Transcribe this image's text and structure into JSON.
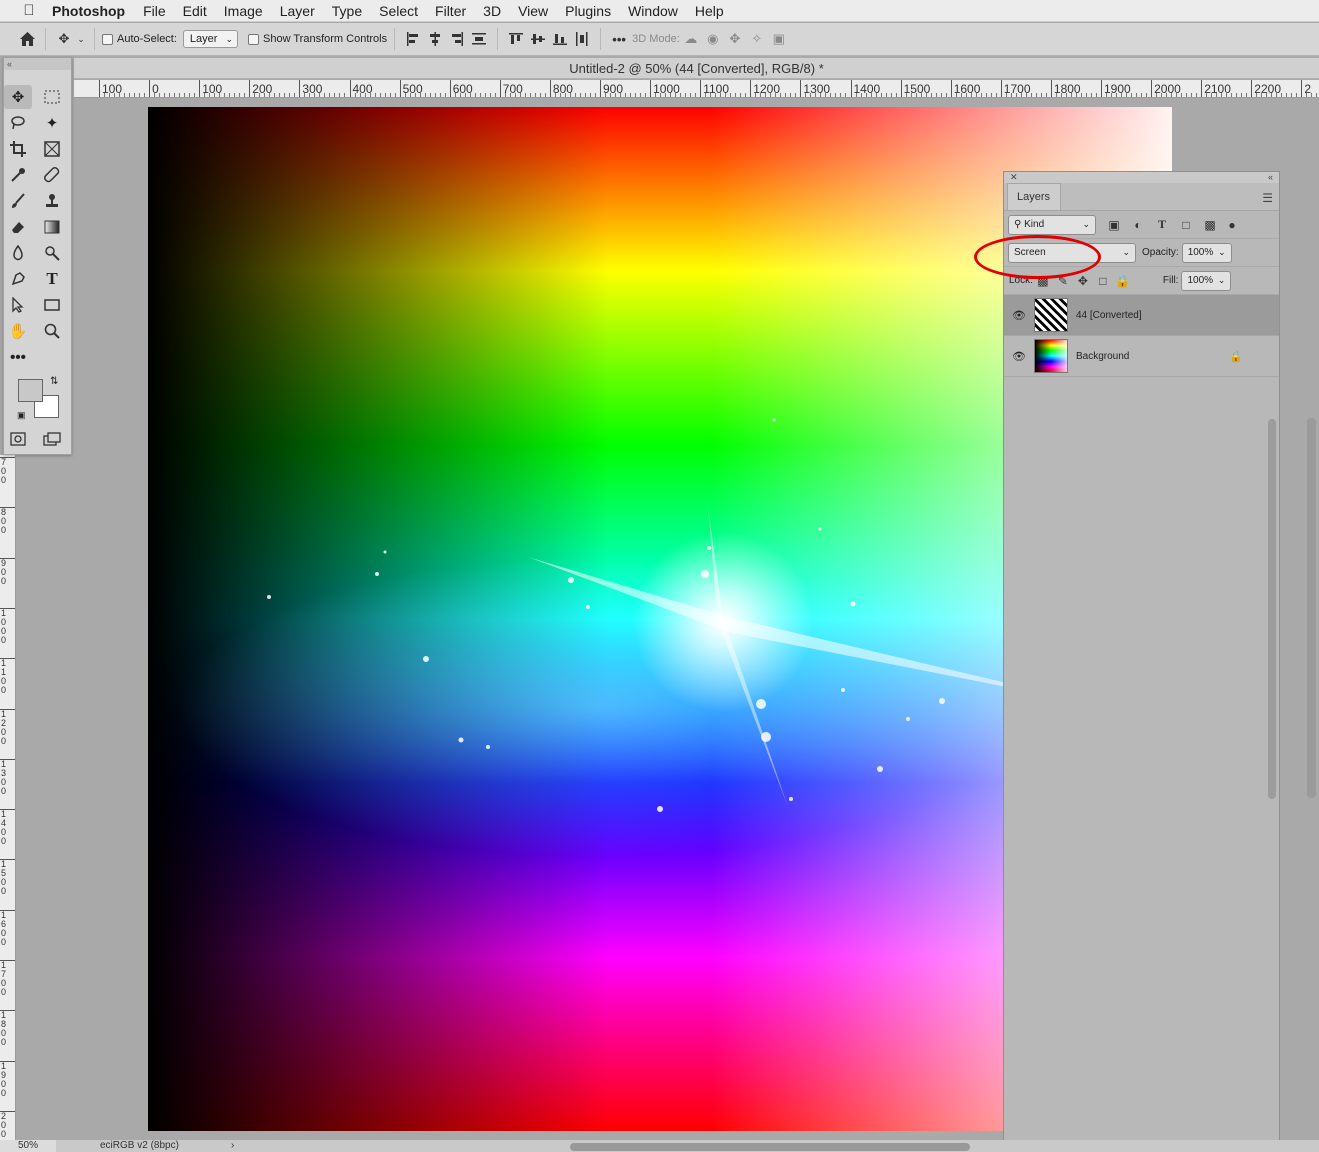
{
  "menubar": {
    "app_name": "Photoshop",
    "items": [
      "File",
      "Edit",
      "Image",
      "Layer",
      "Type",
      "Select",
      "Filter",
      "3D",
      "View",
      "Plugins",
      "Window",
      "Help"
    ]
  },
  "options_bar": {
    "auto_select_label": "Auto-Select:",
    "auto_select_target": "Layer",
    "show_transform_label": "Show Transform Controls",
    "mode_3d_label": "3D Mode:"
  },
  "document": {
    "title": "Untitled-2 @ 50% (44 [Converted], RGB/8) *"
  },
  "ruler": {
    "h_labels": [
      "100",
      "0",
      "100",
      "200",
      "300",
      "400",
      "500",
      "600",
      "700",
      "800",
      "900",
      "1000",
      "1100",
      "1200",
      "1300",
      "1400",
      "1500",
      "1600",
      "1700",
      "1800",
      "1900",
      "2000",
      "2100",
      "2200",
      "2"
    ],
    "v_labels": [
      "7\n0\n0",
      "8\n0\n0",
      "9\n0\n0",
      "1\n0\n0\n0",
      "1\n1\n0\n0",
      "1\n2\n0\n0",
      "1\n3\n0\n0",
      "1\n4\n0\n0",
      "1\n5\n0\n0",
      "1\n6\n0\n0",
      "1\n7\n0\n0",
      "1\n8\n0\n0",
      "1\n9\n0\n0",
      "2\n0\n0"
    ]
  },
  "layers_panel": {
    "tab_label": "Layers",
    "filter_kind": "Kind",
    "blend_mode": "Screen",
    "opacity_label": "Opacity:",
    "opacity_value": "100%",
    "lock_label": "Lock:",
    "fill_label": "Fill:",
    "fill_value": "100%",
    "layers": [
      {
        "name": "44 [Converted]",
        "visible": true,
        "selected": true
      },
      {
        "name": "Background",
        "visible": true,
        "locked": true
      }
    ]
  },
  "status_bar": {
    "zoom": "50%",
    "profile": "eciRGB v2 (8bpc)",
    "arrow": "›"
  },
  "colors": {
    "annotation": "#e10000",
    "foreground_swatch": "#c8c8c8",
    "background_swatch": "#ffffff"
  }
}
